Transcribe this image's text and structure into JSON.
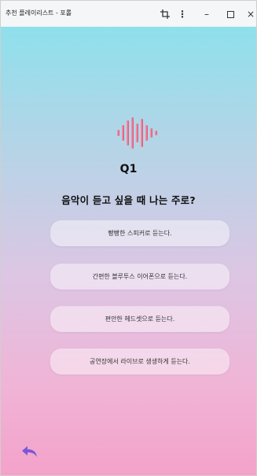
{
  "window": {
    "title": "추천 플레이리스트 - 포롤"
  },
  "quiz": {
    "number": "Q1",
    "question": "음악이 듣고 싶을 때 나는 주로?",
    "options": [
      "빵빵한 스피커로 듣는다.",
      "간편한 블루투스 이어폰으로 듣는다.",
      "편안한 헤드셋으로 듣는다.",
      "공연장에서 라이브로 생생하게 듣는다."
    ]
  },
  "icons": {
    "logo": "sound-wave-icon",
    "back": "undo-arrow-icon",
    "screenshot": "screenshot-icon",
    "more": "more-vertical-icon",
    "minimize": "minimize-icon",
    "maximize": "maximize-icon",
    "close": "close-icon"
  },
  "colors": {
    "wave_gradient_start": "#f48aa0",
    "wave_gradient_end": "#e0577f",
    "back_arrow": "#7b57d8",
    "background_top": "#8fe0ec",
    "background_bottom": "#f4a2ca"
  }
}
